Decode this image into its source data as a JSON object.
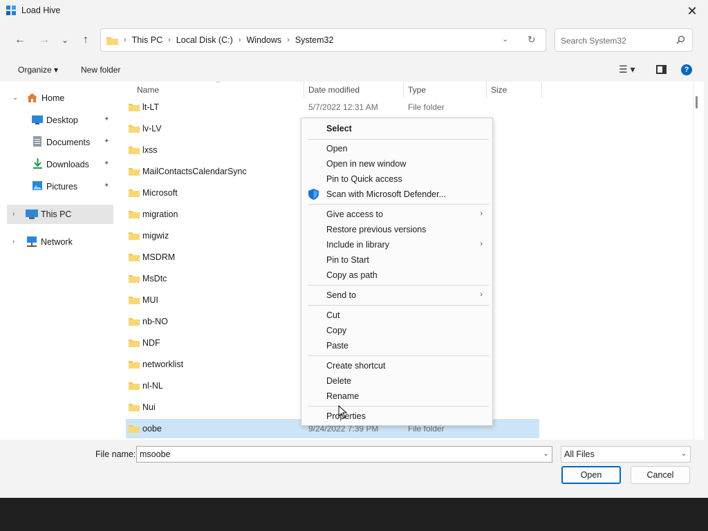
{
  "window": {
    "title": "Load Hive",
    "close_glyph": "✕"
  },
  "nav": {
    "back_glyph": "←",
    "forward_glyph": "→",
    "recent_glyph": "⌄",
    "up_glyph": "↑",
    "breadcrumbs": [
      "This PC",
      "Local Disk (C:)",
      "Windows",
      "System32"
    ],
    "crumb_separator": "›",
    "dropdown_glyph": "⌄",
    "refresh_glyph": "↻",
    "search_placeholder": "Search System32"
  },
  "commandbar": {
    "organize_label": "Organize ▾",
    "new_folder_label": "New folder",
    "view_glyph": "☰ ▾",
    "help_glyph": "?"
  },
  "sidebar": {
    "items": [
      {
        "label": "Home",
        "icon": "home-icon"
      },
      {
        "label": "Desktop",
        "icon": "desktop-icon",
        "pinned": true
      },
      {
        "label": "Documents",
        "icon": "documents-icon",
        "pinned": true
      },
      {
        "label": "Downloads",
        "icon": "downloads-icon",
        "pinned": true
      },
      {
        "label": "Pictures",
        "icon": "pictures-icon",
        "pinned": true
      },
      {
        "label": "This PC",
        "icon": "pc-icon",
        "selected": true
      },
      {
        "label": "Network",
        "icon": "network-icon"
      }
    ],
    "expand_glyph": "›",
    "collapse_glyph": "⌄",
    "pin_glyph": "📌"
  },
  "columns": {
    "name": "Name",
    "date": "Date modified",
    "type": "Type",
    "size": "Size",
    "sort_glyph": "⌃"
  },
  "files": [
    {
      "name": "lt-LT",
      "date": "5/7/2022 12:31 AM",
      "type": "File folder"
    },
    {
      "name": "lv-LV",
      "date": "",
      "type": ""
    },
    {
      "name": "lxss",
      "date": "",
      "type": ""
    },
    {
      "name": "MailContactsCalendarSync",
      "date": "",
      "type": ""
    },
    {
      "name": "Microsoft",
      "date": "",
      "type": ""
    },
    {
      "name": "migration",
      "date": "",
      "type": ""
    },
    {
      "name": "migwiz",
      "date": "",
      "type": ""
    },
    {
      "name": "MSDRM",
      "date": "",
      "type": ""
    },
    {
      "name": "MsDtc",
      "date": "",
      "type": ""
    },
    {
      "name": "MUI",
      "date": "",
      "type": ""
    },
    {
      "name": "nb-NO",
      "date": "",
      "type": ""
    },
    {
      "name": "NDF",
      "date": "",
      "type": ""
    },
    {
      "name": "networklist",
      "date": "",
      "type": ""
    },
    {
      "name": "nl-NL",
      "date": "",
      "type": ""
    },
    {
      "name": "Nui",
      "date": "",
      "type": ""
    },
    {
      "name": "oobe",
      "date": "9/24/2022 7:39 PM",
      "type": "File folder",
      "selected": true
    }
  ],
  "context_menu": {
    "select": "Select",
    "open": "Open",
    "open_new_window": "Open in new window",
    "pin_quick_access": "Pin to Quick access",
    "scan_defender": "Scan with Microsoft Defender...",
    "give_access": "Give access to",
    "restore_versions": "Restore previous versions",
    "include_library": "Include in library",
    "pin_start": "Pin to Start",
    "copy_path": "Copy as path",
    "send_to": "Send to",
    "cut": "Cut",
    "copy": "Copy",
    "paste": "Paste",
    "create_shortcut": "Create shortcut",
    "delete": "Delete",
    "rename": "Rename",
    "properties": "Properties",
    "submenu_glyph": "›"
  },
  "footer": {
    "file_name_label": "File name:",
    "file_name_value": "msoobe",
    "filter_value": "All Files",
    "dropdown_glyph": "⌄",
    "open_label": "Open",
    "cancel_label": "Cancel"
  },
  "colors": {
    "accent": "#0067c0",
    "selection": "#cce4f7",
    "folder": "#f4c453",
    "shield": "#1f6fd1"
  }
}
